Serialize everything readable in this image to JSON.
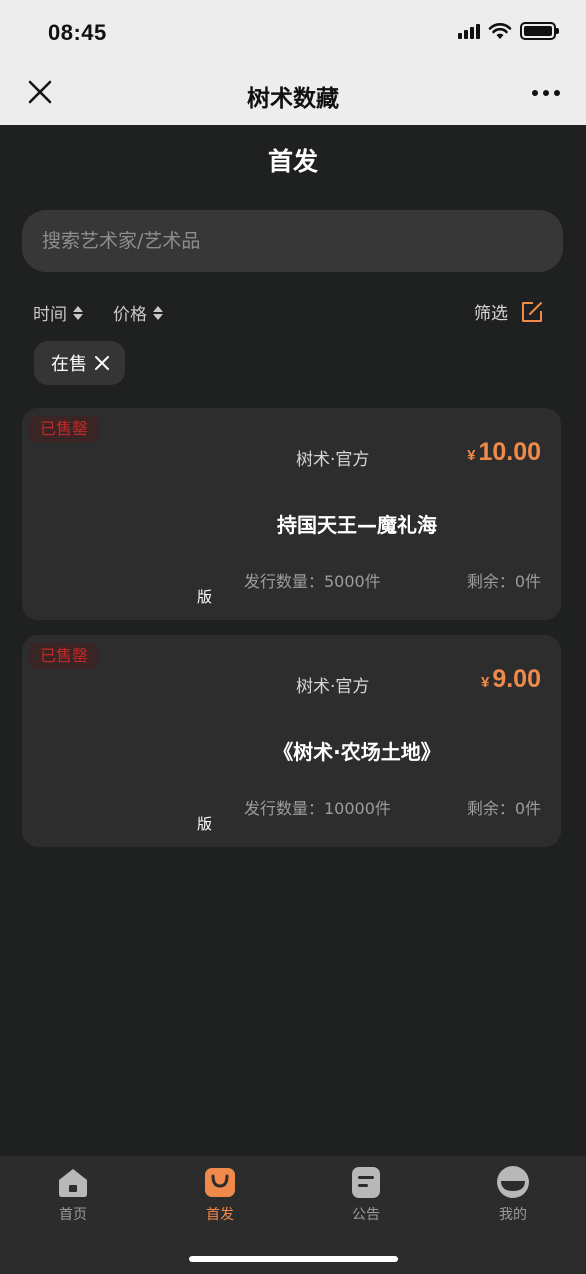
{
  "status_bar": {
    "time": "08:45"
  },
  "nav": {
    "title": "树术数藏"
  },
  "page": {
    "title": "首发"
  },
  "search": {
    "placeholder": "搜索艺术家/艺术品"
  },
  "sort": {
    "time_label": "时间",
    "price_label": "价格"
  },
  "filter": {
    "label": "筛选"
  },
  "active_chip": {
    "label": "在售"
  },
  "products": [
    {
      "badge": "已售罄",
      "issuer": "树术·官方",
      "price_symbol": "¥",
      "price": "10.00",
      "name": "持国天王—魔礼海",
      "edition_tag": "版",
      "supply": "发行数量：5000件",
      "remaining": "剩余：0件"
    },
    {
      "badge": "已售罄",
      "issuer": "树术·官方",
      "price_symbol": "¥",
      "price": "9.00",
      "name": "《树术·农场土地》",
      "edition_tag": "版",
      "supply": "发行数量：10000件",
      "remaining": "剩余：0件"
    }
  ],
  "tabs": [
    {
      "label": "首页",
      "icon": "home-icon"
    },
    {
      "label": "首发",
      "icon": "bag-icon",
      "active": true
    },
    {
      "label": "公告",
      "icon": "notice-icon"
    },
    {
      "label": "我的",
      "icon": "profile-icon"
    }
  ],
  "colors": {
    "accent": "#f08a4b",
    "sold_red": "#c0292a",
    "background": "#1f2020",
    "card": "#2d2d2d"
  }
}
